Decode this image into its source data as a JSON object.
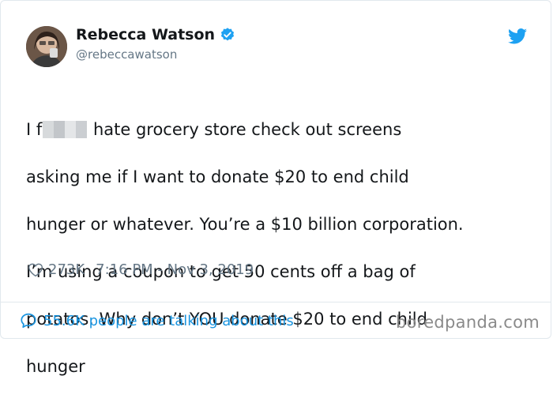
{
  "tweet": {
    "author": {
      "display_name": "Rebecca Watson",
      "handle": "@rebeccawatson",
      "verified": true
    },
    "text": {
      "line1_before": "I f",
      "line1_after": " hate grocery store check out screens",
      "lines": [
        "asking me if I want to donate $20 to end child",
        "hunger or whatever. You’re a $10 billion corporation.",
        "I’m using a coupon to get 50 cents off a bag of",
        "potatos. Why don’t YOU donate $20 to end child",
        "hunger"
      ]
    },
    "likes": "273K",
    "timestamp": "7:16 PM - Nov 3, 2019",
    "conversation": "55.6K people are talking about this"
  },
  "watermark": "boredpanda.com",
  "colors": {
    "accent": "#1b95e0",
    "twitter_blue": "#1da1f2",
    "text": "#14171a",
    "secondary_text": "#657786",
    "border": "#e1e8ed"
  },
  "icons": [
    "verified-badge-icon",
    "twitter-bird-icon",
    "heart-icon",
    "speech-bubble-icon"
  ]
}
